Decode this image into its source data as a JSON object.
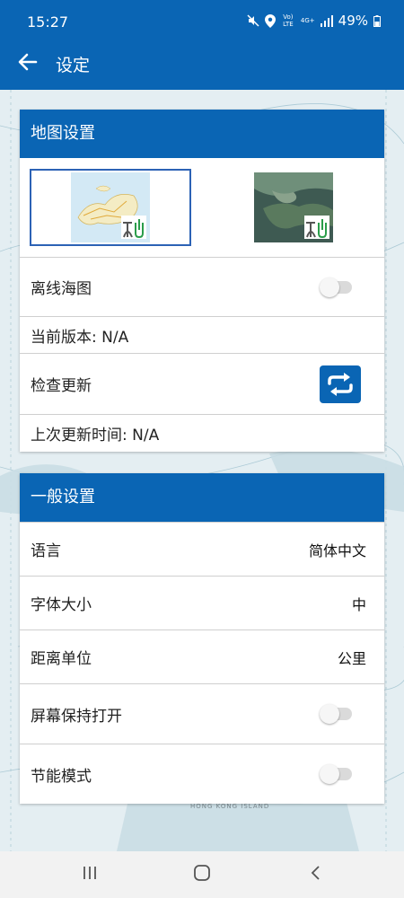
{
  "status_bar": {
    "time": "15:27",
    "battery": "49%",
    "network": "4G+",
    "volte": "Vo) LTE"
  },
  "app_bar": {
    "title": "设定",
    "back_icon": "arrow-left-icon"
  },
  "map_settings": {
    "header": "地图设置",
    "map_options": [
      {
        "name": "nautical-chart-thumbnail",
        "selected": true
      },
      {
        "name": "satellite-thumbnail",
        "selected": false
      }
    ],
    "offline_chart_label": "离线海图",
    "offline_chart_on": false,
    "current_version_label": "当前版本: N/A",
    "check_update_label": "检查更新",
    "last_update_label": "上次更新时间: N/A"
  },
  "general_settings": {
    "header": "一般设置",
    "language_label": "语言",
    "language_value": "简体中文",
    "font_size_label": "字体大小",
    "font_size_value": "中",
    "distance_unit_label": "距离单位",
    "distance_unit_value": "公里",
    "keep_screen_on_label": "屏幕保持打开",
    "keep_screen_on": false,
    "power_saving_label": "节能模式",
    "power_saving": false
  },
  "map_background": {
    "label": "HONG KONG ISLAND"
  },
  "colors": {
    "primary": "#0a65b4",
    "selected_border": "#2c62b5"
  }
}
